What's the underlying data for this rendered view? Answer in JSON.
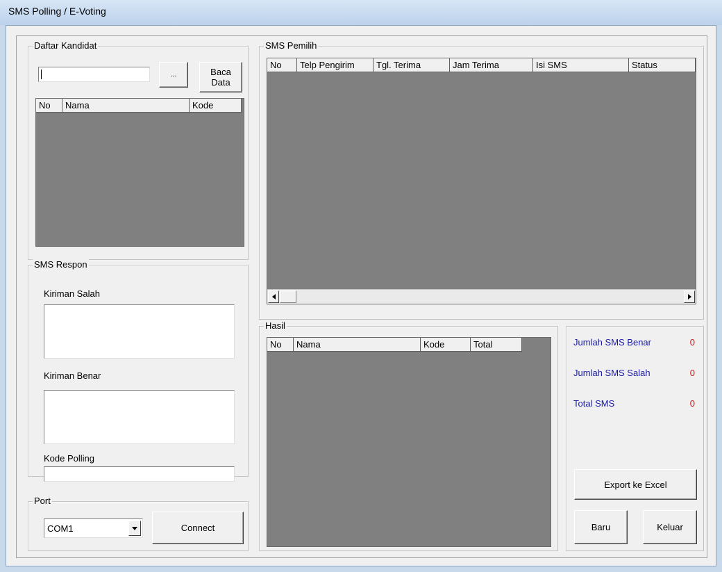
{
  "window": {
    "title": "SMS Polling / E-Voting"
  },
  "kandidat": {
    "group_title": "Daftar Kandidat",
    "file_value": "",
    "browse_label": "...",
    "load_label_line1": "Baca",
    "load_label_line2": "Data",
    "columns": [
      "No",
      "Nama",
      "Kode"
    ]
  },
  "respon": {
    "group_title": "SMS Respon",
    "wrong_label": "Kiriman Salah",
    "wrong_value": "",
    "right_label": "Kiriman Benar",
    "right_value": "",
    "code_label": "Kode Polling",
    "code_value": ""
  },
  "port": {
    "group_title": "Port",
    "selected": "COM1",
    "connect_label": "Connect"
  },
  "pemilih": {
    "group_title": "SMS Pemilih",
    "columns": [
      "No",
      "Telp Pengirim",
      "Tgl. Terima",
      "Jam Terima",
      "Isi SMS",
      "Status"
    ]
  },
  "hasil": {
    "group_title": "Hasil",
    "columns": [
      "No",
      "Nama",
      "Kode",
      "Total"
    ]
  },
  "stats": {
    "benar_label": "Jumlah SMS Benar",
    "benar_value": "0",
    "salah_label": "Jumlah SMS Salah",
    "salah_value": "0",
    "total_label": "Total SMS",
    "total_value": "0"
  },
  "actions": {
    "export_label": "Export ke Excel",
    "new_label": "Baru",
    "exit_label": "Keluar"
  }
}
